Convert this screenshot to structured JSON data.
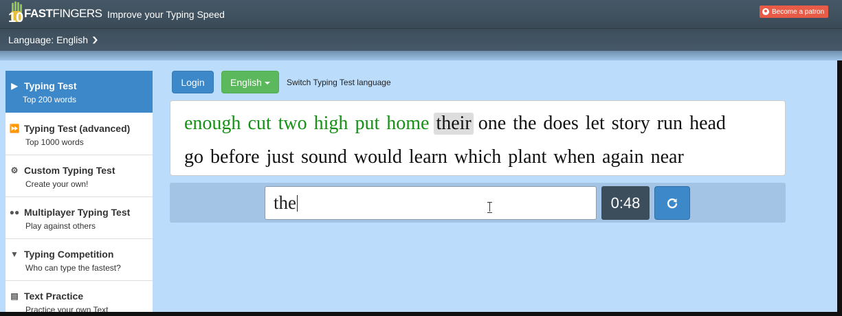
{
  "header": {
    "logo_number": "10",
    "logo_word_bold": "FAST",
    "logo_word_rest": "FINGERS",
    "tagline": "Improve your Typing Speed",
    "patron_label": "Become a patron"
  },
  "language_bar": {
    "label": "Language: English"
  },
  "sidebar": {
    "items": [
      {
        "title": "Typing Test",
        "subtitle": "Top 200 words",
        "icon": "play-icon",
        "active": true
      },
      {
        "title": "Typing Test (advanced)",
        "subtitle": "Top 1000 words",
        "icon": "fast-forward-icon"
      },
      {
        "title": "Custom Typing Test",
        "subtitle": "Create your own!",
        "icon": "cogs-icon"
      },
      {
        "title": "Multiplayer Typing Test",
        "subtitle": "Play against others",
        "icon": "users-icon"
      },
      {
        "title": "Typing Competition",
        "subtitle": "Who can type the fastest?",
        "icon": "trophy-icon"
      },
      {
        "title": "Text Practice",
        "subtitle": "Practice your own Text",
        "icon": "document-icon"
      }
    ]
  },
  "controls": {
    "login_label": "Login",
    "language_button_label": "English",
    "switch_label": "Switch Typing Test language"
  },
  "test": {
    "row1": [
      {
        "text": "enough",
        "state": "correct"
      },
      {
        "text": "cut",
        "state": "correct"
      },
      {
        "text": "two",
        "state": "correct"
      },
      {
        "text": "high",
        "state": "correct"
      },
      {
        "text": "put",
        "state": "correct"
      },
      {
        "text": "home",
        "state": "correct"
      },
      {
        "text": "their",
        "state": "current"
      },
      {
        "text": "one",
        "state": "pending"
      },
      {
        "text": "the",
        "state": "pending"
      },
      {
        "text": "does",
        "state": "pending"
      },
      {
        "text": "let",
        "state": "pending"
      },
      {
        "text": "story",
        "state": "pending"
      },
      {
        "text": "run",
        "state": "pending"
      },
      {
        "text": "head",
        "state": "pending"
      }
    ],
    "row2": [
      {
        "text": "go",
        "state": "pending"
      },
      {
        "text": "before",
        "state": "pending"
      },
      {
        "text": "just",
        "state": "pending"
      },
      {
        "text": "sound",
        "state": "pending"
      },
      {
        "text": "would",
        "state": "pending"
      },
      {
        "text": "learn",
        "state": "pending"
      },
      {
        "text": "which",
        "state": "pending"
      },
      {
        "text": "plant",
        "state": "pending"
      },
      {
        "text": "when",
        "state": "pending"
      },
      {
        "text": "again",
        "state": "pending"
      },
      {
        "text": "near",
        "state": "pending"
      }
    ],
    "input_value": "the",
    "timer": "0:48",
    "colors": {
      "correct": "#169116",
      "current_bg": "#dddddd",
      "accent": "#3d88c8"
    }
  }
}
